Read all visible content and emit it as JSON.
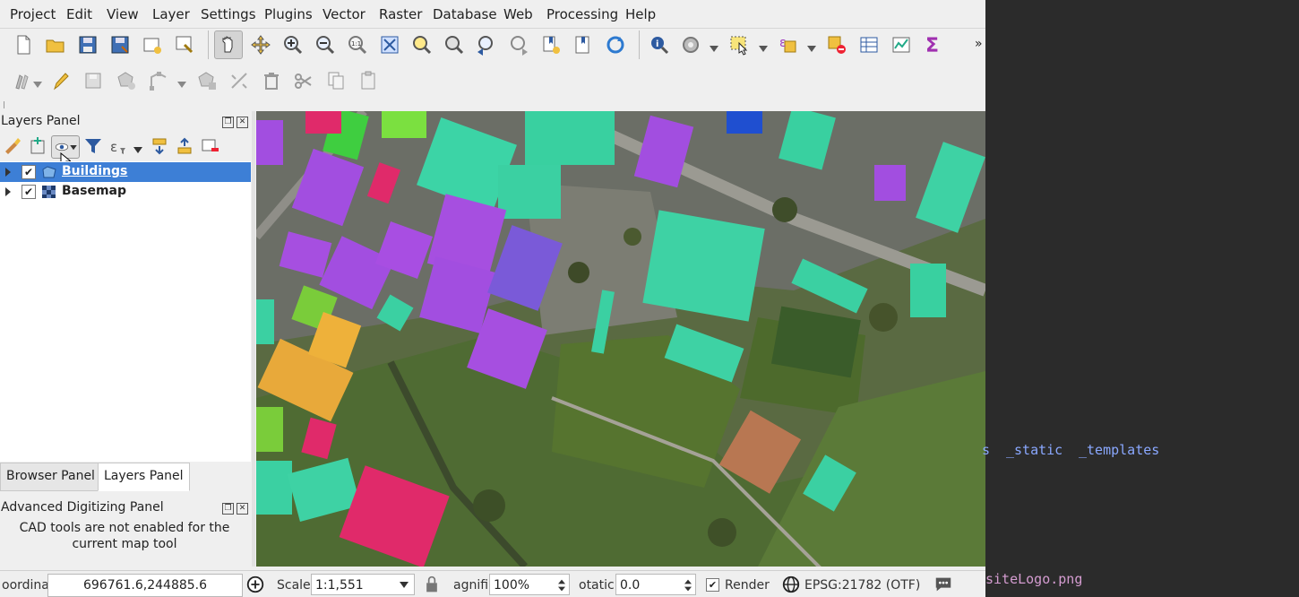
{
  "menu": [
    "Project",
    "Edit",
    "View",
    "Layer",
    "Settings",
    "Plugins",
    "Vector",
    "Raster",
    "Database",
    "Web",
    "Processing",
    "Help"
  ],
  "toolbar_overflow": "»",
  "layers_panel": {
    "title": "Layers Panel",
    "layers": [
      {
        "name": "Buildings",
        "checked": true,
        "selected": true,
        "icon": "polygon-layer-icon"
      },
      {
        "name": "Basemap",
        "checked": true,
        "selected": false,
        "icon": "raster-layer-icon"
      }
    ]
  },
  "tabs": {
    "browser": "Browser Panel",
    "layers": "Layers Panel"
  },
  "advanced_digitizing": {
    "title": "Advanced Digitizing Panel",
    "message": "CAD tools are not enabled for the current map tool"
  },
  "status": {
    "coordinate_label": "oordina",
    "coordinate": "696761.6,244885.6",
    "scale_label": "Scale",
    "scale": "1:1,551",
    "magnifier_label": "agnifi",
    "magnifier": "100%",
    "rotation_label": "otatic",
    "rotation": "0.0",
    "render_label": "Render",
    "render_checked": true,
    "crs": "EPSG:21782 (OTF)"
  },
  "terminal": {
    "line1_a": "s",
    "line1_b": "_static",
    "line1_c": "_templates",
    "line2": "siteLogo.png"
  }
}
